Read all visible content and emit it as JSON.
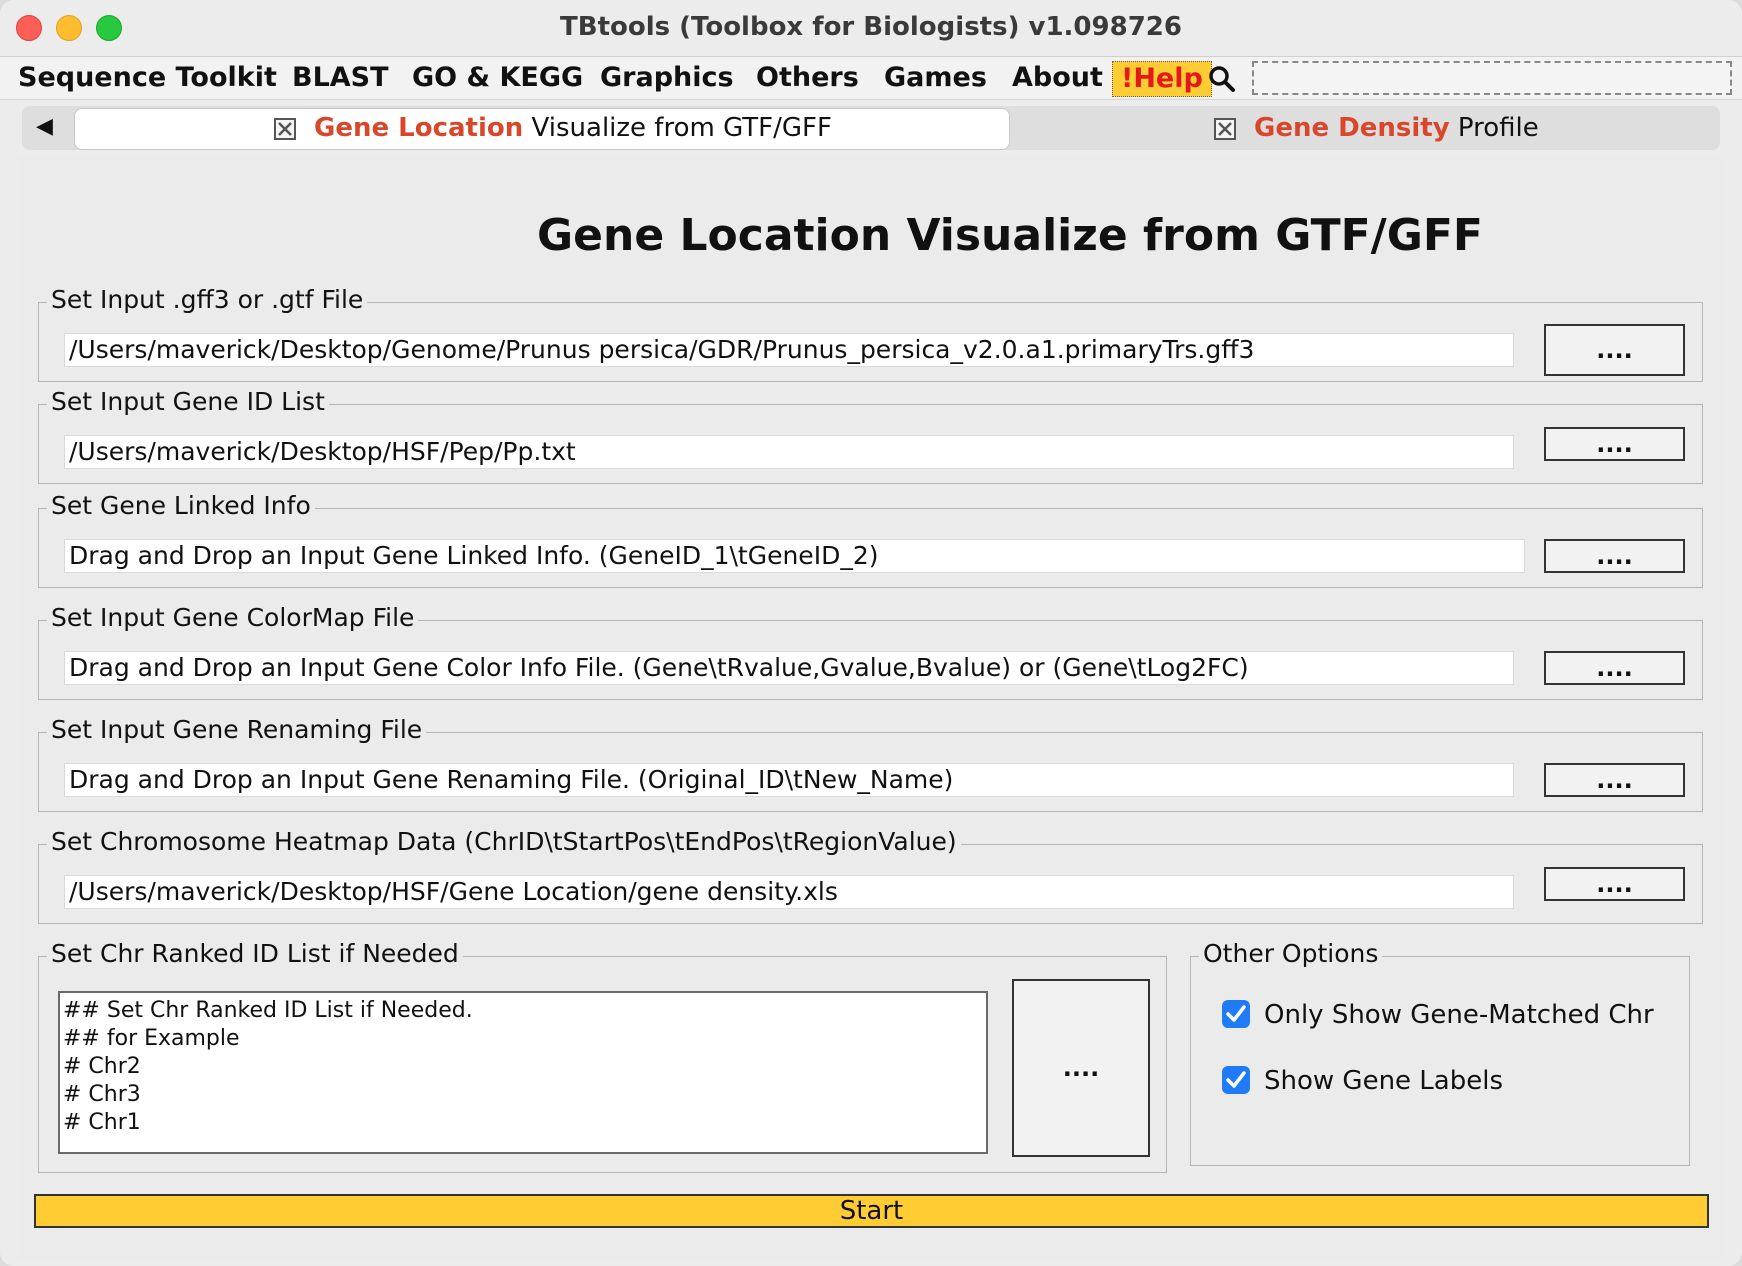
{
  "window": {
    "title": "TBtools (Toolbox for Biologists) v1.098726"
  },
  "menu": {
    "items": [
      "Sequence Toolkit",
      "BLAST",
      "GO & KEGG",
      "Graphics",
      "Others",
      "Games",
      "About"
    ],
    "help": "!Help"
  },
  "tabs": [
    {
      "highlight": "Gene Location",
      "rest": " Visualize from GTF/GFF",
      "active": true
    },
    {
      "highlight": "Gene Density",
      "rest": " Profile",
      "active": false
    }
  ],
  "page": {
    "title": "Gene Location Visualize from GTF/GFF",
    "browse_label": "....",
    "sections": {
      "input_file": {
        "legend": "Set Input .gff3 or .gtf File",
        "value": "/Users/maverick/Desktop/Genome/Prunus persica/GDR/Prunus_persica_v2.0.a1.primaryTrs.gff3"
      },
      "gene_id_list": {
        "legend": "Set Input Gene ID List",
        "value": "/Users/maverick/Desktop/HSF/Pep/Pp.txt"
      },
      "linked_info": {
        "legend": "Set Gene Linked Info",
        "placeholder": "Drag and Drop an Input Gene Linked Info. (GeneID_1\\tGeneID_2)"
      },
      "colormap": {
        "legend": "Set Input Gene ColorMap File",
        "placeholder": "Drag and Drop an Input Gene Color Info File. (Gene\\tRvalue,Gvalue,Bvalue) or (Gene\\tLog2FC)"
      },
      "renaming": {
        "legend": "Set Input Gene Renaming File",
        "placeholder": "Drag and Drop an Input Gene Renaming File. (Original_ID\\tNew_Name)"
      },
      "heatmap": {
        "legend": "Set Chromosome Heatmap Data (ChrID\\tStartPos\\tEndPos\\tRegionValue)",
        "value": "/Users/maverick/Desktop/HSF/Gene Location/gene density.xls"
      },
      "chr_ranked": {
        "legend": "Set Chr Ranked ID List if Needed",
        "text": "## Set Chr Ranked ID List if Needed.\n## for Example\n# Chr2\n# Chr3\n# Chr1"
      },
      "other_options": {
        "legend": "Other Options",
        "only_show_matched": {
          "label": "Only Show Gene-Matched Chr",
          "checked": true
        },
        "show_labels": {
          "label": "Show Gene Labels",
          "checked": true
        }
      }
    },
    "start_label": "Start"
  },
  "colors": {
    "accent": "#ffcc33",
    "tab_highlight": "#d9472b",
    "checkbox": "#1f7bf6"
  }
}
